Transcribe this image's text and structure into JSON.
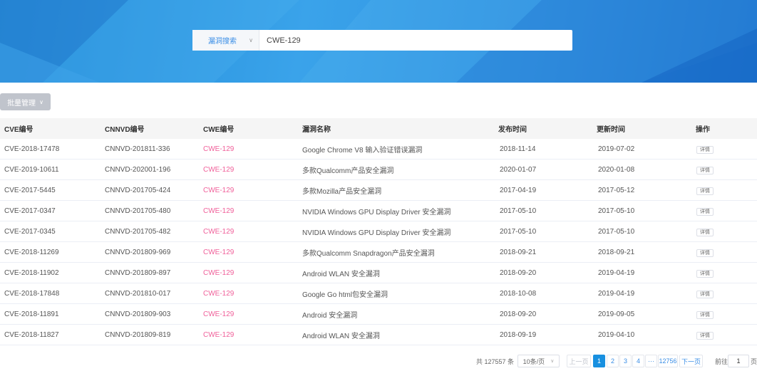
{
  "search": {
    "type_label": "漏洞搜索",
    "query": "CWE-129"
  },
  "batch_label": "批量管理",
  "table": {
    "headers": [
      "CVE编号",
      "CNNVD编号",
      "CWE编号",
      "漏洞名称",
      "发布时间",
      "更新时间",
      "操作"
    ],
    "detail_label": "详情",
    "rows": [
      {
        "cve": "CVE-2018-17478",
        "cnnvd": "CNNVD-201811-336",
        "cwe": "CWE-129",
        "name": "Google Chrome V8 输入验证错误漏洞",
        "published": "2018-11-14",
        "updated": "2019-07-02"
      },
      {
        "cve": "CVE-2019-10611",
        "cnnvd": "CNNVD-202001-196",
        "cwe": "CWE-129",
        "name": "多款Qualcomm产品安全漏洞",
        "published": "2020-01-07",
        "updated": "2020-01-08"
      },
      {
        "cve": "CVE-2017-5445",
        "cnnvd": "CNNVD-201705-424",
        "cwe": "CWE-129",
        "name": "多款Mozilla产品安全漏洞",
        "published": "2017-04-19",
        "updated": "2017-05-12"
      },
      {
        "cve": "CVE-2017-0347",
        "cnnvd": "CNNVD-201705-480",
        "cwe": "CWE-129",
        "name": "NVIDIA Windows GPU Display Driver 安全漏洞",
        "published": "2017-05-10",
        "updated": "2017-05-10"
      },
      {
        "cve": "CVE-2017-0345",
        "cnnvd": "CNNVD-201705-482",
        "cwe": "CWE-129",
        "name": "NVIDIA Windows GPU Display Driver 安全漏洞",
        "published": "2017-05-10",
        "updated": "2017-05-10"
      },
      {
        "cve": "CVE-2018-11269",
        "cnnvd": "CNNVD-201809-969",
        "cwe": "CWE-129",
        "name": "多款Qualcomm Snapdragon产品安全漏洞",
        "published": "2018-09-21",
        "updated": "2018-09-21"
      },
      {
        "cve": "CVE-2018-11902",
        "cnnvd": "CNNVD-201809-897",
        "cwe": "CWE-129",
        "name": "Android WLAN 安全漏洞",
        "published": "2018-09-20",
        "updated": "2019-04-19"
      },
      {
        "cve": "CVE-2018-17848",
        "cnnvd": "CNNVD-201810-017",
        "cwe": "CWE-129",
        "name": "Google Go html包安全漏洞",
        "published": "2018-10-08",
        "updated": "2019-04-19"
      },
      {
        "cve": "CVE-2018-11891",
        "cnnvd": "CNNVD-201809-903",
        "cwe": "CWE-129",
        "name": "Android 安全漏洞",
        "published": "2018-09-20",
        "updated": "2019-09-05"
      },
      {
        "cve": "CVE-2018-11827",
        "cnnvd": "CNNVD-201809-819",
        "cwe": "CWE-129",
        "name": "Android WLAN 安全漏洞",
        "published": "2018-09-19",
        "updated": "2019-04-10"
      }
    ]
  },
  "pagination": {
    "total_label": "共 127557 条",
    "page_size": "10条/页",
    "prev_label": "上一页",
    "pages": [
      "1",
      "2",
      "3",
      "4"
    ],
    "ellipsis": "···",
    "last_page": "12756",
    "next_label": "下一页",
    "goto_label": "前往",
    "goto_value": "1",
    "page_suffix": "页",
    "current_page": "1"
  }
}
